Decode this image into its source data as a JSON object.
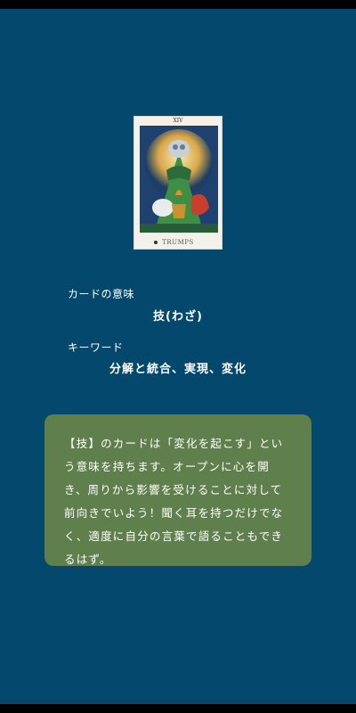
{
  "card": {
    "numeral": "XIV",
    "title": "TRUMPS"
  },
  "meaning": {
    "label": "カードの意味",
    "value": "技(わざ)"
  },
  "keywords": {
    "label": "キーワード",
    "value": "分解と統合、実現、変化"
  },
  "description": "【技】のカードは「変化を起こす」という意味を持ちます。オープンに心を開き、周りから影響を受けることに対して前向きでいよう！聞く耳を持つだけでなく、適度に自分の言葉で語ることもできるはず。",
  "colors": {
    "background": "#05486d",
    "panel": "#5f804c",
    "text": "#ffffff"
  }
}
